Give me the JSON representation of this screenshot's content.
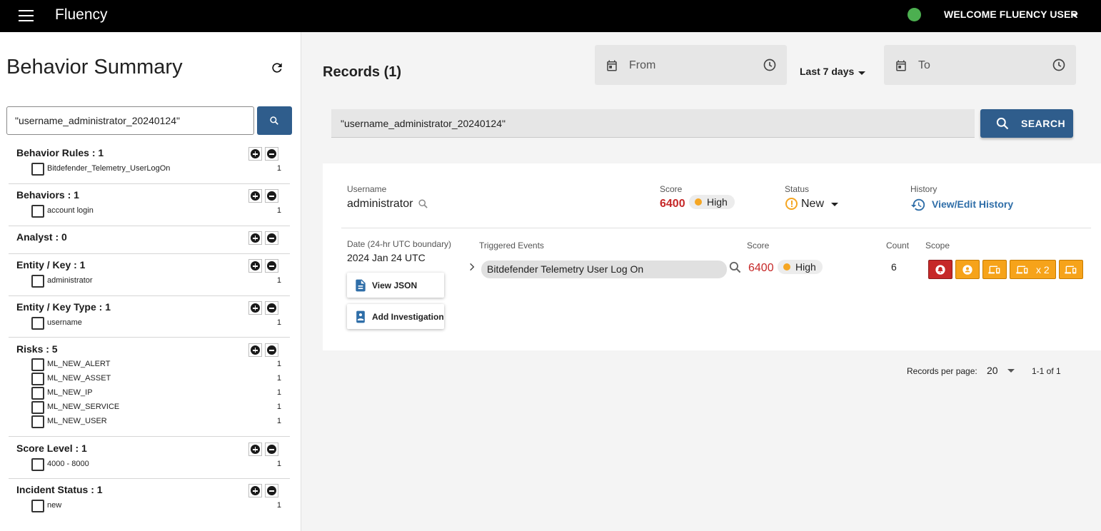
{
  "topbar": {
    "brand": "Fluency",
    "user": "WELCOME FLUENCY USER"
  },
  "sidebar": {
    "title": "Behavior Summary",
    "search_value": "\"username_administrator_20240124\"",
    "facets": [
      {
        "header": "Behavior Rules : 1",
        "items": [
          {
            "label": "Bitdefender_Telemetry_UserLogOn",
            "count": "1"
          }
        ]
      },
      {
        "header": "Behaviors : 1",
        "items": [
          {
            "label": "account login",
            "count": "1"
          }
        ]
      },
      {
        "header": "Analyst : 0",
        "items": []
      },
      {
        "header": "Entity / Key : 1",
        "items": [
          {
            "label": "administrator",
            "count": "1"
          }
        ]
      },
      {
        "header": "Entity / Key Type : 1",
        "items": [
          {
            "label": "username",
            "count": "1"
          }
        ]
      },
      {
        "header": "Risks : 5",
        "items": [
          {
            "label": "ML_NEW_ALERT",
            "count": "1"
          },
          {
            "label": "ML_NEW_ASSET",
            "count": "1"
          },
          {
            "label": "ML_NEW_IP",
            "count": "1"
          },
          {
            "label": "ML_NEW_SERVICE",
            "count": "1"
          },
          {
            "label": "ML_NEW_USER",
            "count": "1"
          }
        ]
      },
      {
        "header": "Score Level : 1",
        "items": [
          {
            "label": "4000 - 8000",
            "count": "1"
          }
        ]
      },
      {
        "header": "Incident Status : 1",
        "items": [
          {
            "label": "new",
            "count": "1"
          }
        ]
      }
    ]
  },
  "main": {
    "records_title": "Records (1)",
    "from_label": "From",
    "to_label": "To",
    "range": "Last 7 days",
    "search_value": "\"username_administrator_20240124\"",
    "search_button": "SEARCH"
  },
  "record": {
    "username_label": "Username",
    "username": "administrator",
    "score_label": "Score",
    "score": "6400",
    "severity": "High",
    "status_label": "Status",
    "status": "New",
    "history_label": "History",
    "history_link": "View/Edit History",
    "date_label": "Date (24-hr UTC boundary)",
    "date": "2024 Jan 24 UTC",
    "view_json": "View JSON",
    "add_investigation": "Add Investigation",
    "events_label": "Triggered Events",
    "event_name": "Bitdefender Telemetry User Log On",
    "event_score_label": "Score",
    "event_score": "6400",
    "event_severity": "High",
    "count_label": "Count",
    "count": "6",
    "scope_label": "Scope",
    "scope_multiplier": "x 2"
  },
  "pagination": {
    "per_page_label": "Records per page:",
    "per_page": "20",
    "range": "1-1 of 1"
  },
  "colors": {
    "accent": "#2f5d8c",
    "link": "#2f6ea8",
    "score_red": "#c62828",
    "severity_orange": "#f5a623",
    "scope_orange": "#f6a31a",
    "online_green": "#4caf50"
  },
  "icons": [
    "menu-icon",
    "refresh-icon",
    "search-icon",
    "calendar-icon",
    "clock-icon",
    "history-icon",
    "warning-icon",
    "document-icon",
    "badge-icon",
    "chevron-right-icon",
    "alarm-icon",
    "person-icon",
    "devices-icon"
  ]
}
